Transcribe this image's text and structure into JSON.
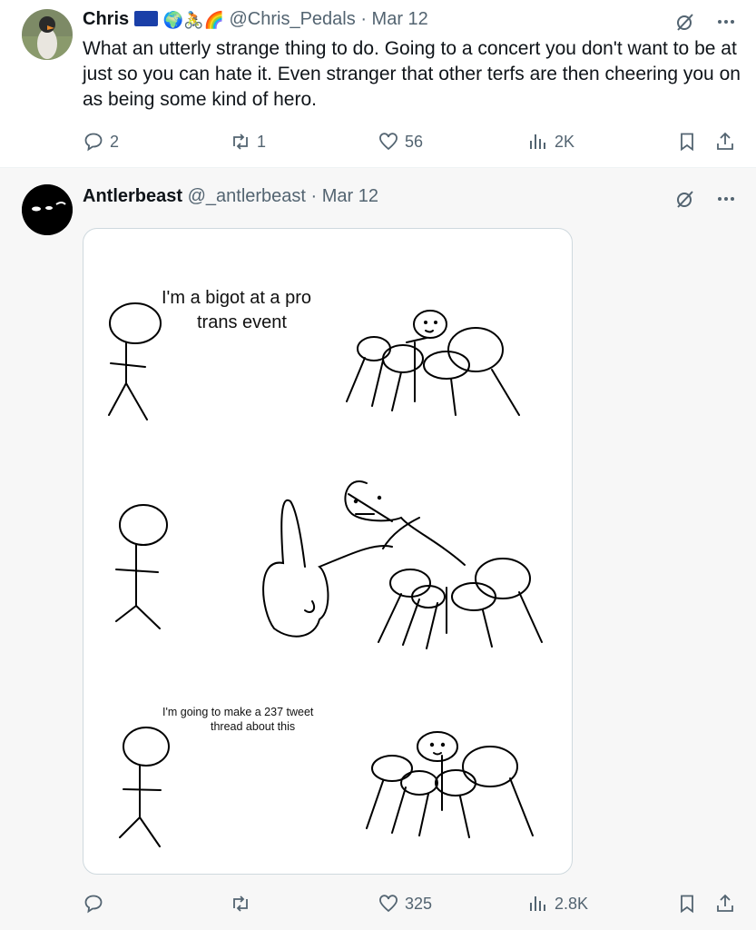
{
  "tweets": [
    {
      "name": "Chris",
      "emojis": "🌍🚴🌈",
      "handle": "@Chris_Pedals",
      "date": "· Mar 12",
      "text": "What an utterly strange thing to do.  Going to a concert you don't want to be at just so you can hate it.  Even stranger that other terfs are then cheering you on as being some kind of hero.",
      "replies": "2",
      "reposts": "1",
      "likes": "56",
      "views": "2K"
    },
    {
      "name": "Antlerbeast",
      "handle": "@_antlerbeast",
      "date": "· Mar 12",
      "replies": "",
      "reposts": "",
      "likes": "325",
      "views": "2.8K",
      "comic": {
        "panel1_line1": "I'm a bigot at a pro",
        "panel1_line2": "trans event",
        "panel3_line1": "I'm going to make a 237 tweet",
        "panel3_line2": "thread about this"
      }
    }
  ],
  "icons": [
    "reply-icon",
    "repost-icon",
    "like-icon",
    "views-icon",
    "bookmark-icon",
    "share-icon",
    "grok-icon",
    "more-icon"
  ]
}
